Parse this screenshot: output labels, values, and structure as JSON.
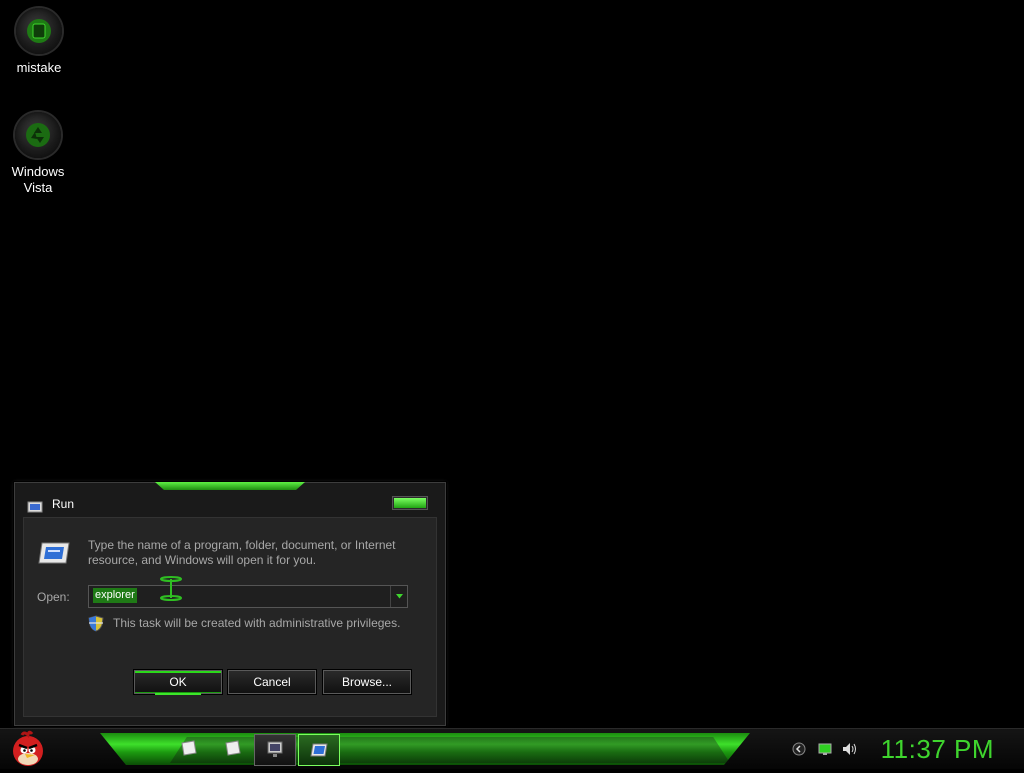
{
  "desktop": {
    "icons": [
      {
        "label": "mistake",
        "icon": "green-disc-icon"
      },
      {
        "label": "Windows Vista",
        "icon": "recycle-bin-icon"
      }
    ]
  },
  "run_dialog": {
    "title": "Run",
    "description": "Type the name of a program, folder, document, or Internet resource, and Windows will open it for you.",
    "open_label": "Open:",
    "open_value": "explorer",
    "admin_note": "This task will be created with administrative privileges.",
    "buttons": {
      "ok": "OK",
      "cancel": "Cancel",
      "browse": "Browse..."
    }
  },
  "taskbar": {
    "start_icon": "angry-bird-start-icon",
    "quick_launch": [
      "note-icon",
      "note-icon"
    ],
    "items": [
      {
        "icon": "remote-desktop-icon",
        "active": false
      },
      {
        "icon": "run-icon",
        "active": true
      }
    ],
    "tray_icons": [
      "back-icon",
      "network-icon",
      "volume-icon"
    ],
    "clock": "11:37 PM"
  },
  "colors": {
    "accent": "#3fd52e",
    "background": "#000000"
  }
}
